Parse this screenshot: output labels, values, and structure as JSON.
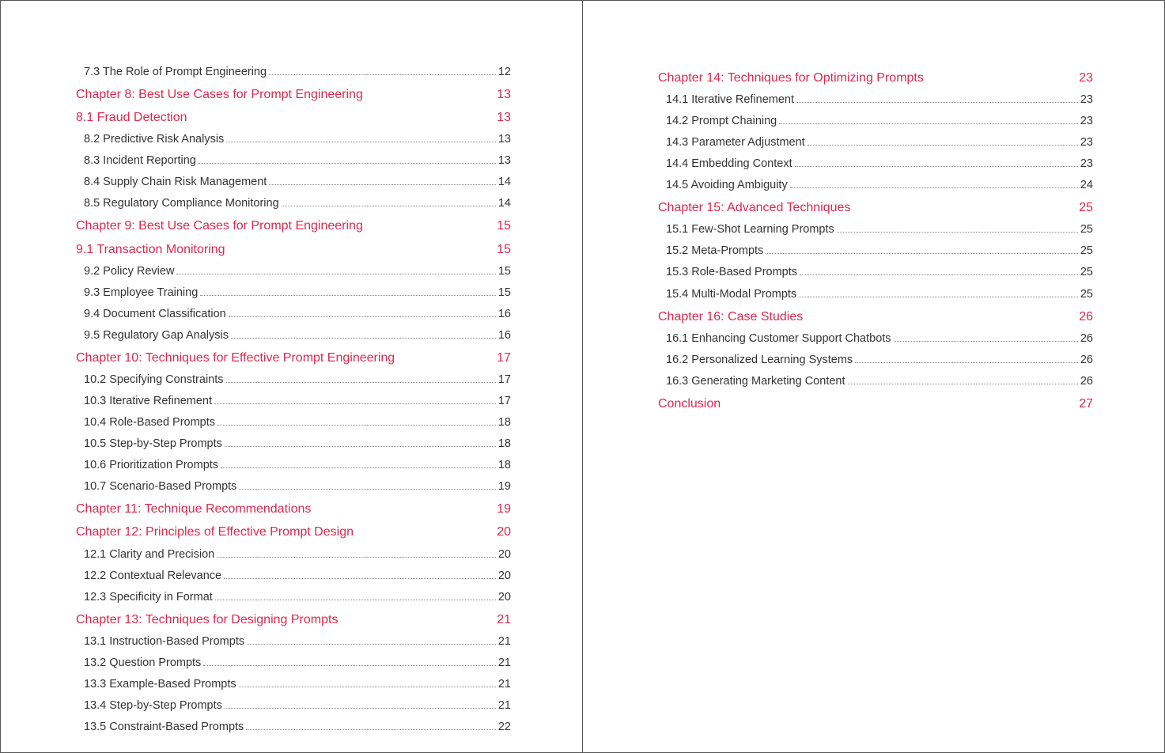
{
  "colors": {
    "accent": "#e2264d",
    "text": "#333333"
  },
  "pages": {
    "left": [
      {
        "type": "sub",
        "label": "7.3 The Role of Prompt Engineering",
        "page": "12"
      },
      {
        "type": "heading",
        "label": "Chapter 8: Best Use Cases for Prompt Engineering",
        "page": "13"
      },
      {
        "type": "heading",
        "label": "8.1 Fraud Detection",
        "page": "13"
      },
      {
        "type": "sub",
        "label": "8.2 Predictive Risk Analysis",
        "page": "13"
      },
      {
        "type": "sub",
        "label": "8.3 Incident Reporting",
        "page": "13"
      },
      {
        "type": "sub",
        "label": "8.4 Supply Chain Risk Management",
        "page": "14"
      },
      {
        "type": "sub",
        "label": "8.5 Regulatory Compliance Monitoring",
        "page": "14"
      },
      {
        "type": "heading",
        "label": "Chapter 9: Best Use Cases for Prompt Engineering",
        "page": "15"
      },
      {
        "type": "heading",
        "label": "9.1 Transaction Monitoring",
        "page": "15"
      },
      {
        "type": "sub",
        "label": "9.2 Policy Review",
        "page": "15"
      },
      {
        "type": "sub",
        "label": "9.3 Employee Training",
        "page": "15"
      },
      {
        "type": "sub",
        "label": "9.4 Document Classification",
        "page": "16"
      },
      {
        "type": "sub",
        "label": "9.5 Regulatory Gap Analysis",
        "page": "16"
      },
      {
        "type": "heading",
        "label": "Chapter 10: Techniques for Effective Prompt Engineering",
        "page": "17"
      },
      {
        "type": "sub",
        "label": "10.2 Specifying Constraints",
        "page": "17"
      },
      {
        "type": "sub",
        "label": "10.3 Iterative Refinement",
        "page": "17"
      },
      {
        "type": "sub",
        "label": "10.4 Role-Based Prompts",
        "page": "18"
      },
      {
        "type": "sub",
        "label": "10.5 Step-by-Step Prompts",
        "page": "18"
      },
      {
        "type": "sub",
        "label": "10.6 Prioritization Prompts",
        "page": "18"
      },
      {
        "type": "sub",
        "label": "10.7 Scenario-Based Prompts",
        "page": "19"
      },
      {
        "type": "heading",
        "label": "Chapter 11: Technique Recommendations",
        "page": "19"
      },
      {
        "type": "heading",
        "label": "Chapter 12: Principles of Effective Prompt Design",
        "page": "20"
      },
      {
        "type": "sub",
        "label": "12.1 Clarity and Precision",
        "page": "20"
      },
      {
        "type": "sub",
        "label": "12.2 Contextual Relevance",
        "page": "20"
      },
      {
        "type": "sub",
        "label": "12.3 Specificity in Format",
        "page": "20"
      },
      {
        "type": "heading",
        "label": "Chapter 13: Techniques for Designing Prompts",
        "page": "21"
      },
      {
        "type": "sub",
        "label": "13.1 Instruction-Based Prompts",
        "page": "21"
      },
      {
        "type": "sub",
        "label": "13.2 Question Prompts",
        "page": "21"
      },
      {
        "type": "sub",
        "label": "13.3 Example-Based Prompts",
        "page": "21"
      },
      {
        "type": "sub",
        "label": "13.4 Step-by-Step Prompts",
        "page": "21"
      },
      {
        "type": "sub",
        "label": "13.5 Constraint-Based Prompts",
        "page": "22"
      }
    ],
    "right": [
      {
        "type": "heading",
        "label": "Chapter 14: Techniques for Optimizing Prompts",
        "page": "23"
      },
      {
        "type": "sub",
        "label": "14.1 Iterative Refinement",
        "page": "23"
      },
      {
        "type": "sub",
        "label": "14.2 Prompt Chaining",
        "page": "23"
      },
      {
        "type": "sub",
        "label": "14.3 Parameter Adjustment",
        "page": "23"
      },
      {
        "type": "sub",
        "label": "14.4 Embedding Context",
        "page": "23"
      },
      {
        "type": "sub",
        "label": "14.5 Avoiding Ambiguity",
        "page": "24"
      },
      {
        "type": "heading",
        "label": "Chapter 15: Advanced Techniques",
        "page": "25"
      },
      {
        "type": "sub",
        "label": "15.1 Few-Shot Learning Prompts",
        "page": "25"
      },
      {
        "type": "sub",
        "label": "15.2 Meta-Prompts",
        "page": "25"
      },
      {
        "type": "sub",
        "label": "15.3 Role-Based Prompts",
        "page": "25"
      },
      {
        "type": "sub",
        "label": "15.4 Multi-Modal Prompts",
        "page": "25"
      },
      {
        "type": "heading",
        "label": "Chapter 16: Case Studies",
        "page": "26"
      },
      {
        "type": "sub",
        "label": "16.1 Enhancing Customer Support Chatbots",
        "page": "26"
      },
      {
        "type": "sub",
        "label": "16.2 Personalized Learning Systems",
        "page": "26"
      },
      {
        "type": "sub",
        "label": "16.3 Generating Marketing Content",
        "page": "26"
      },
      {
        "type": "heading",
        "label": "Conclusion",
        "page": "27"
      }
    ]
  }
}
